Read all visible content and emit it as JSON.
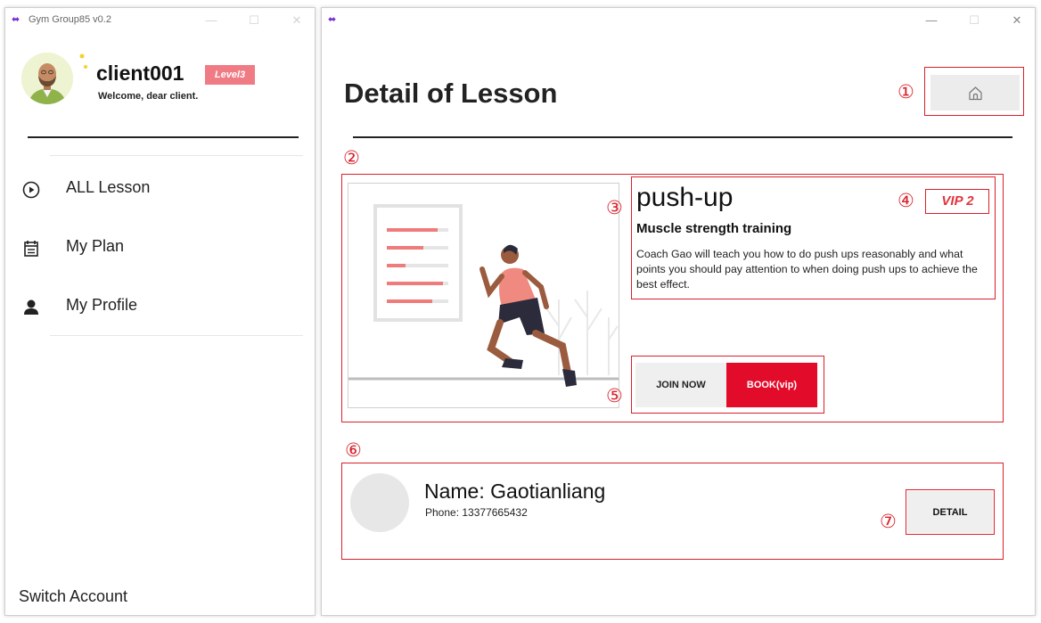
{
  "left_window": {
    "title": "Gym Group85 v0.2",
    "logo_glyph": "⬌",
    "controls": {
      "minimize": "—",
      "maximize": "☐",
      "close": "✕"
    },
    "user": {
      "name": "client001",
      "level": "Level3",
      "welcome": "Welcome, dear client."
    },
    "nav": [
      {
        "label": "ALL Lesson",
        "icon": "play-circle-icon"
      },
      {
        "label": "My Plan",
        "icon": "calendar-icon"
      },
      {
        "label": "My Profile",
        "icon": "person-icon"
      }
    ],
    "switch_account": "Switch Account"
  },
  "right_window": {
    "logo_glyph": "⬌",
    "controls": {
      "minimize": "—",
      "maximize": "☐",
      "close": "✕"
    },
    "page_title": "Detail of Lesson",
    "home_button_icon": "home-icon",
    "lesson": {
      "name": "push-up",
      "vip": "VIP 2",
      "subtitle": "Muscle strength training",
      "description": "Coach Gao will teach you how to do push ups reasonably and what points you should pay attention to when doing push ups to achieve the best effect."
    },
    "actions": {
      "join": "JOIN NOW",
      "book": "BOOK(vip)"
    },
    "coach": {
      "name": "Name: Gaotianliang",
      "phone": "Phone: 13377665432"
    },
    "detail_button": "DETAIL"
  },
  "annotations": [
    "①",
    "②",
    "③",
    "④",
    "⑤",
    "⑥",
    "⑦"
  ],
  "colors": {
    "accent_red": "#e30b2a",
    "annotation_red": "#d9202a",
    "level_badge": "#f07b85",
    "button_gray": "#efefef"
  }
}
